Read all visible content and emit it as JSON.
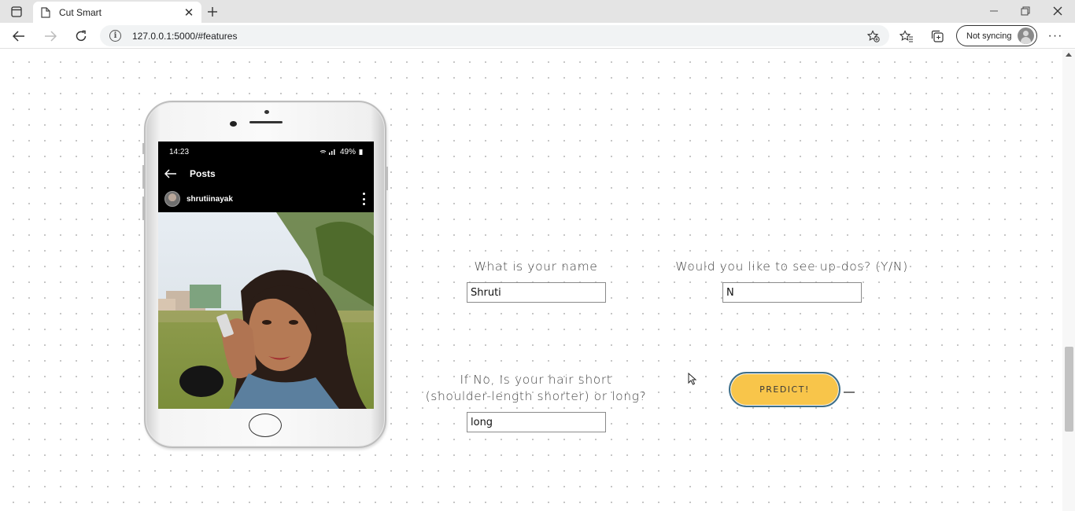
{
  "browser": {
    "tab_title": "Cut Smart",
    "url": "127.0.0.1:5000/#features",
    "profile_label": "Not syncing"
  },
  "phone_screen": {
    "time": "14:23",
    "battery": "49%",
    "header_title": "Posts",
    "username": "shrutiinayak"
  },
  "form": {
    "name_label": "What is your name",
    "name_value": "Shruti",
    "updos_label": "Would you like to see up-dos? (Y/N)",
    "updos_value": "N",
    "hair_label": "If No, Is your hair short (shoulder-length shorter) or long?",
    "hair_value": "long",
    "predict_label": "PREDICT!"
  },
  "colors": {
    "predict_button": "#f8c54a",
    "predict_border": "#3c6e8a"
  }
}
